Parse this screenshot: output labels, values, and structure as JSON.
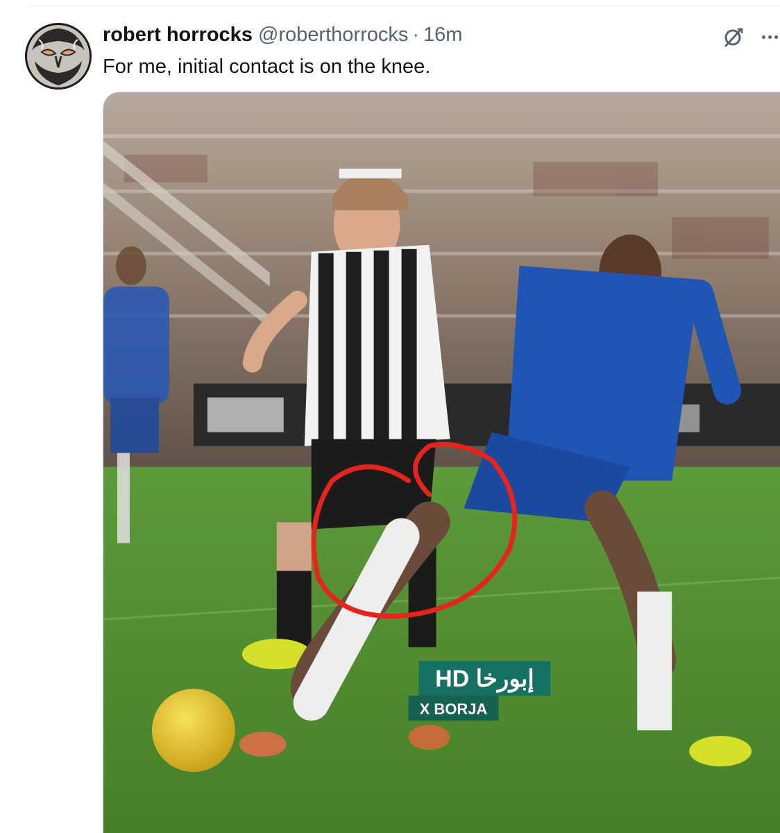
{
  "tweet": {
    "display_name": "robert horrocks",
    "handle": "@roberthorrocks",
    "separator": "·",
    "timestamp": "16m",
    "text": "For me, initial contact is on the knee."
  },
  "icons": {
    "grok": "grok-icon",
    "more": "more-horizontal-icon"
  },
  "media": {
    "type": "image",
    "overlay_watermark": "HD إبورخا",
    "overlay_sub": "X BORJA",
    "annotation": "red circle around knee contact"
  },
  "colors": {
    "name": "#0f1419",
    "secondary": "#536471",
    "pitch": "#4f8a2f",
    "annotation_red": "#e5241b",
    "chelsea_blue": "#1f55b5"
  }
}
